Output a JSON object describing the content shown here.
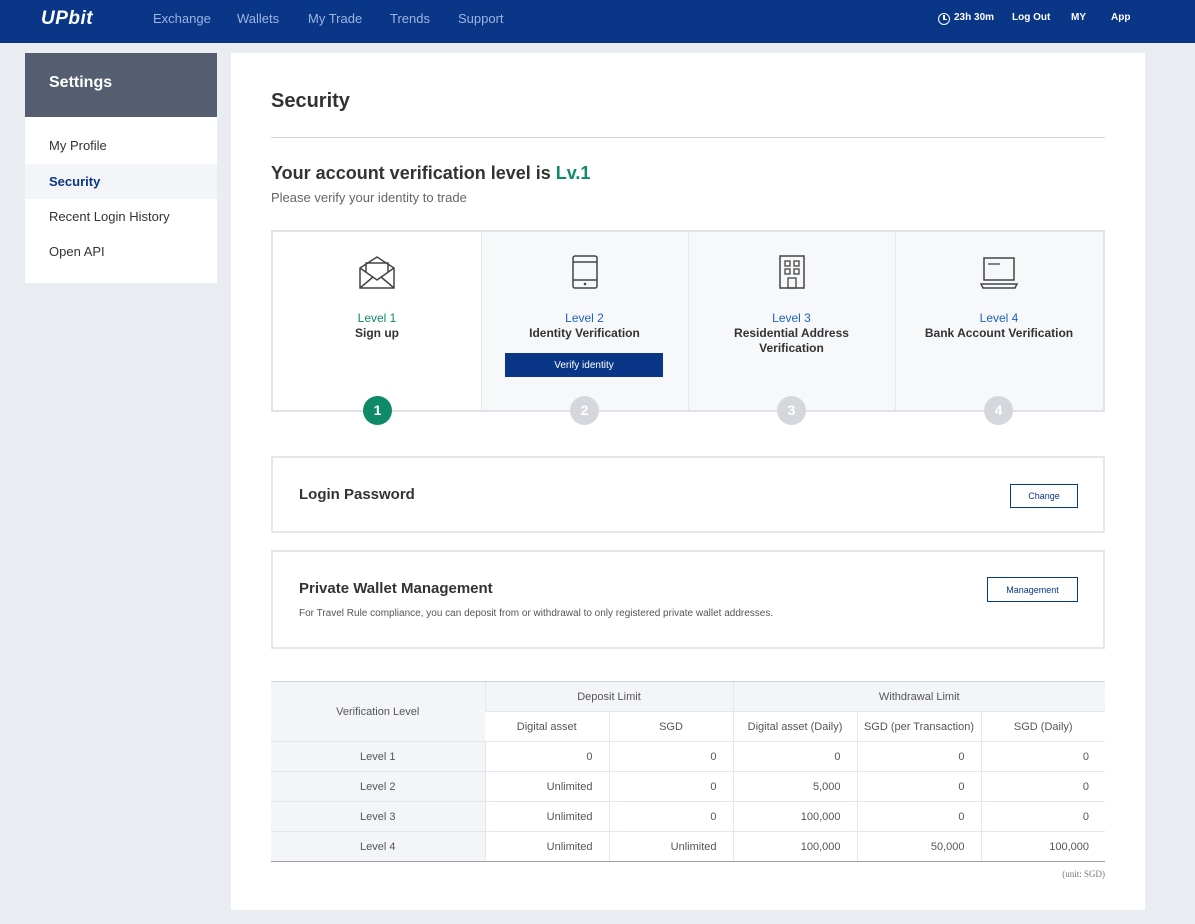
{
  "topnav": {
    "logo": "UPbit",
    "items": [
      "Exchange",
      "Wallets",
      "My Trade",
      "Trends",
      "Support"
    ],
    "session_time": "23h 30m",
    "logout": "Log Out",
    "my": "MY",
    "app": "App"
  },
  "sidebar": {
    "title": "Settings",
    "items": [
      {
        "label": "My Profile"
      },
      {
        "label": "Security"
      },
      {
        "label": "Recent Login History"
      },
      {
        "label": "Open API"
      }
    ],
    "active": "Security"
  },
  "main": {
    "title": "Security",
    "heading_prefix": "Your account verification level is ",
    "heading_level": "Lv.1",
    "subtitle": "Please verify your identity to trade",
    "levels": [
      {
        "num": "Level 1",
        "name": "Sign up",
        "step": "1",
        "icon": "envelope-icon"
      },
      {
        "num": "Level 2",
        "name": "Identity Verification",
        "step": "2",
        "icon": "tablet-icon",
        "button": "Verify identity"
      },
      {
        "num": "Level 3",
        "name": "Residential Address Verification",
        "step": "3",
        "icon": "building-icon"
      },
      {
        "num": "Level 4",
        "name": "Bank Account Verification",
        "step": "4",
        "icon": "laptop-icon"
      }
    ],
    "login_password": {
      "title": "Login Password",
      "button": "Change"
    },
    "private_wallet": {
      "title": "Private Wallet Management",
      "description": "For Travel Rule compliance, you can deposit from or withdrawal to only registered private wallet addresses.",
      "button": "Management"
    },
    "limits_table": {
      "col_level": "Verification Level",
      "deposit_header": "Deposit Limit",
      "withdrawal_header": "Withdrawal Limit",
      "sub_headers": [
        "Digital asset",
        "SGD",
        "Digital asset (Daily)",
        "SGD (per Transaction)",
        "SGD (Daily)"
      ],
      "rows": [
        [
          "Level 1",
          "0",
          "0",
          "0",
          "0",
          "0"
        ],
        [
          "Level 2",
          "Unlimited",
          "0",
          "5,000",
          "0",
          "0"
        ],
        [
          "Level 3",
          "Unlimited",
          "0",
          "100,000",
          "0",
          "0"
        ],
        [
          "Level 4",
          "Unlimited",
          "Unlimited",
          "100,000",
          "50,000",
          "100,000"
        ]
      ],
      "unit_note": "(unit: SGD)"
    }
  },
  "colors": {
    "nav_bg": "#093687",
    "accent_green": "#0e8a67",
    "link_blue": "#1f5fc1"
  }
}
